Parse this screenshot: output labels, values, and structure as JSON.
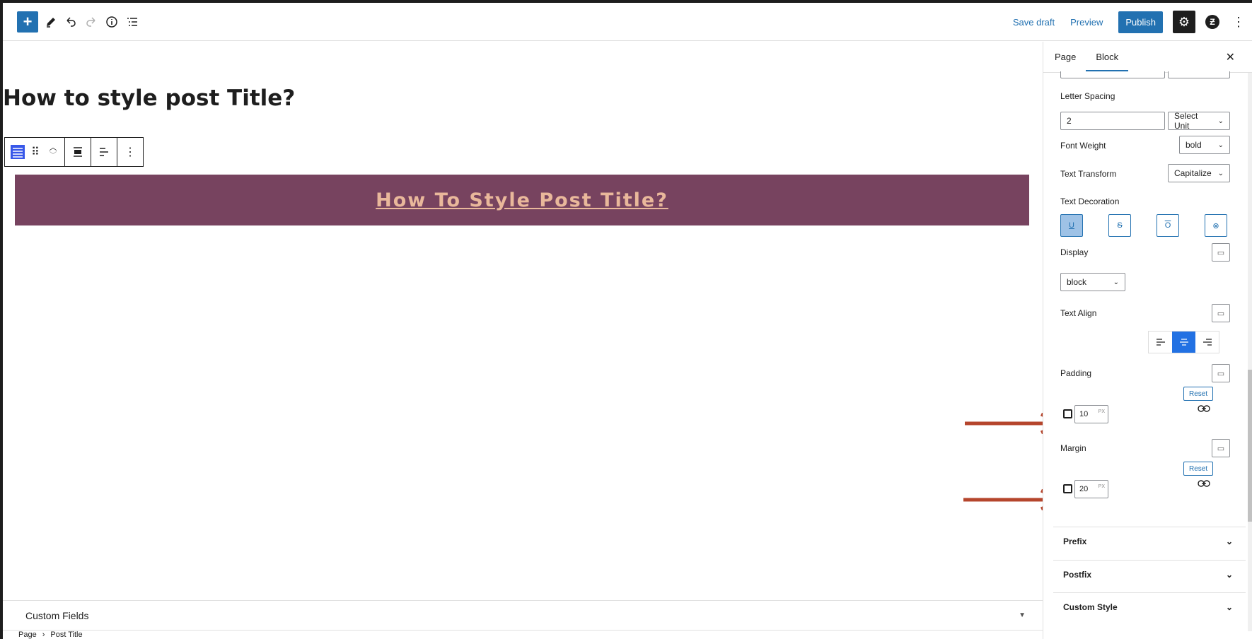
{
  "toolbar": {
    "add_label": "+",
    "save_draft": "Save draft",
    "preview": "Preview",
    "publish": "Publish"
  },
  "editor": {
    "page_title": "How to style post Title?",
    "banner_text": "How To Style Post Title?",
    "banner_bg": "#77435f",
    "banner_text_color": "#e9b89b"
  },
  "footer": {
    "custom_fields": "Custom Fields",
    "breadcrumb": [
      "Page",
      "Post Title"
    ]
  },
  "sidebar": {
    "tabs": [
      "Page",
      "Block"
    ],
    "active_tab": "Block",
    "letter_spacing": {
      "label": "Letter Spacing",
      "value": "2",
      "unit": "Select Unit"
    },
    "font_weight": {
      "label": "Font Weight",
      "value": "bold"
    },
    "text_transform": {
      "label": "Text Transform",
      "value": "Capitalize"
    },
    "text_decoration": {
      "label": "Text Decoration",
      "active": "underline"
    },
    "display": {
      "label": "Display",
      "value": "block"
    },
    "text_align": {
      "label": "Text Align",
      "active": "center"
    },
    "padding": {
      "label": "Padding",
      "reset": "Reset",
      "value": "10",
      "unit": "PX"
    },
    "margin": {
      "label": "Margin",
      "reset": "Reset",
      "value": "20",
      "unit": "PX"
    },
    "panels": [
      "Prefix",
      "Postfix",
      "Custom Style"
    ]
  },
  "colors": {
    "accent": "#2271b1",
    "annotation_arrow": "#b5452c"
  }
}
